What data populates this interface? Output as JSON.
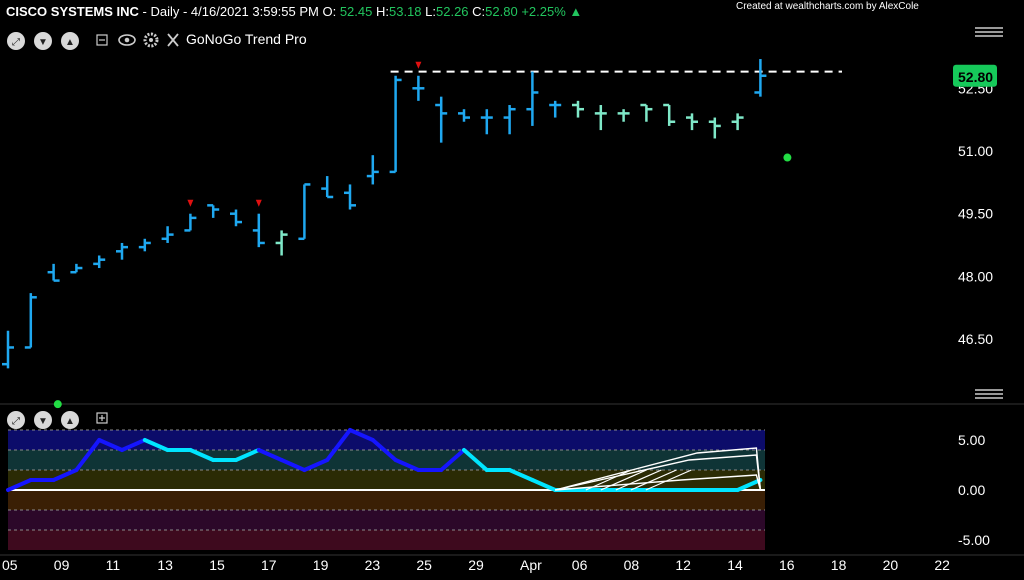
{
  "header": {
    "symbol": "CISCO SYSTEMS INC",
    "info": " - Daily - 4/16/2021 3:59:55 PM ",
    "o_label": "O: ",
    "o_value": "52.45",
    "h_label": " H:",
    "h_value": "53.18",
    "l_label": " L:",
    "l_value": "52.26",
    "c_label": " C:",
    "c_value": "52.80",
    "change": " +2.25%",
    "credit": "Created at wealthcharts.com by AlexCole",
    "indicator_name": "GoNoGo Trend Pro"
  },
  "colors": {
    "background": "#000000",
    "go_strong": "#1fa8f0",
    "go_weak": "#7fe8c8",
    "signal": "#e01010",
    "dot": "#22dd44",
    "osc_blue": "#1515ff",
    "osc_cyan": "#00e5ff",
    "price_badge": "#16c95a"
  },
  "chart_data": {
    "type": "ohlc",
    "price_axis": {
      "ticks": [
        46.5,
        48.0,
        49.5,
        51.0,
        52.5
      ],
      "tick_labels": [
        "46.50",
        "48.00",
        "49.50",
        "51.00",
        "52.50"
      ],
      "last_price_label": "52.80"
    },
    "x_tick_labels": [
      "05",
      "09",
      "11",
      "13",
      "15",
      "17",
      "19",
      "23",
      "25",
      "29",
      "Apr",
      "06",
      "08",
      "12",
      "14",
      "16",
      "18",
      "20",
      "22"
    ],
    "bars": [
      {
        "o": 45.9,
        "h": 46.7,
        "l": 45.8,
        "c": 46.3,
        "s": "strong"
      },
      {
        "o": 46.3,
        "h": 47.6,
        "l": 46.3,
        "c": 47.5,
        "s": "strong"
      },
      {
        "o": 48.1,
        "h": 48.3,
        "l": 47.9,
        "c": 47.9,
        "s": "strong"
      },
      {
        "o": 48.1,
        "h": 48.3,
        "l": 48.1,
        "c": 48.2,
        "s": "strong"
      },
      {
        "o": 48.3,
        "h": 48.5,
        "l": 48.2,
        "c": 48.4,
        "s": "strong"
      },
      {
        "o": 48.6,
        "h": 48.8,
        "l": 48.4,
        "c": 48.7,
        "s": "strong"
      },
      {
        "o": 48.7,
        "h": 48.9,
        "l": 48.6,
        "c": 48.8,
        "s": "strong"
      },
      {
        "o": 48.9,
        "h": 49.2,
        "l": 48.8,
        "c": 49.0,
        "s": "strong"
      },
      {
        "o": 49.1,
        "h": 49.5,
        "l": 49.1,
        "c": 49.4,
        "s": "strong"
      },
      {
        "o": 49.7,
        "h": 49.7,
        "l": 49.4,
        "c": 49.6,
        "s": "strong"
      },
      {
        "o": 49.5,
        "h": 49.6,
        "l": 49.2,
        "c": 49.3,
        "s": "strong"
      },
      {
        "o": 49.1,
        "h": 49.5,
        "l": 48.7,
        "c": 48.8,
        "s": "strong"
      },
      {
        "o": 48.8,
        "h": 49.1,
        "l": 48.5,
        "c": 49.0,
        "s": "weak"
      },
      {
        "o": 48.9,
        "h": 50.2,
        "l": 48.9,
        "c": 50.2,
        "s": "strong"
      },
      {
        "o": 50.1,
        "h": 50.4,
        "l": 49.9,
        "c": 49.9,
        "s": "strong"
      },
      {
        "o": 50.0,
        "h": 50.2,
        "l": 49.6,
        "c": 49.7,
        "s": "strong"
      },
      {
        "o": 50.4,
        "h": 50.9,
        "l": 50.2,
        "c": 50.5,
        "s": "strong"
      },
      {
        "o": 50.5,
        "h": 52.8,
        "l": 50.5,
        "c": 52.7,
        "s": "strong"
      },
      {
        "o": 52.5,
        "h": 52.8,
        "l": 52.2,
        "c": 52.5,
        "s": "strong"
      },
      {
        "o": 52.1,
        "h": 52.3,
        "l": 51.2,
        "c": 51.9,
        "s": "strong"
      },
      {
        "o": 51.9,
        "h": 52.0,
        "l": 51.7,
        "c": 51.8,
        "s": "strong"
      },
      {
        "o": 51.8,
        "h": 52.0,
        "l": 51.4,
        "c": 51.8,
        "s": "strong"
      },
      {
        "o": 51.8,
        "h": 52.1,
        "l": 51.4,
        "c": 52.0,
        "s": "strong"
      },
      {
        "o": 52.0,
        "h": 52.9,
        "l": 51.6,
        "c": 52.4,
        "s": "strong"
      },
      {
        "o": 52.1,
        "h": 52.2,
        "l": 51.8,
        "c": 52.1,
        "s": "strong"
      },
      {
        "o": 52.1,
        "h": 52.2,
        "l": 51.8,
        "c": 52.0,
        "s": "weak"
      },
      {
        "o": 51.9,
        "h": 52.1,
        "l": 51.5,
        "c": 51.9,
        "s": "weak"
      },
      {
        "o": 51.9,
        "h": 52.0,
        "l": 51.7,
        "c": 51.9,
        "s": "weak"
      },
      {
        "o": 52.1,
        "h": 52.1,
        "l": 51.7,
        "c": 52.0,
        "s": "weak"
      },
      {
        "o": 52.1,
        "h": 52.1,
        "l": 51.6,
        "c": 51.7,
        "s": "weak"
      },
      {
        "o": 51.8,
        "h": 51.9,
        "l": 51.5,
        "c": 51.7,
        "s": "weak"
      },
      {
        "o": 51.7,
        "h": 51.8,
        "l": 51.3,
        "c": 51.6,
        "s": "weak"
      },
      {
        "o": 51.7,
        "h": 51.9,
        "l": 51.5,
        "c": 51.8,
        "s": "weak"
      },
      {
        "o": 52.4,
        "h": 53.2,
        "l": 52.3,
        "c": 52.8,
        "s": "strong"
      }
    ],
    "resistance_level": 52.9,
    "signal_markers": [
      8,
      11,
      18
    ],
    "dot_markers": [
      {
        "bar": 1,
        "price": 45.9
      },
      {
        "bar": 33,
        "price": 51.8
      }
    ],
    "oscillator": {
      "ticks": [
        5,
        0,
        -5
      ],
      "tick_labels": [
        "5.00",
        "0.00",
        "-5.00"
      ],
      "values": [
        0,
        1,
        1,
        2,
        5,
        4,
        5,
        4,
        4,
        3,
        3,
        4,
        3,
        2,
        3,
        6,
        5,
        3,
        2,
        2,
        4,
        2,
        2,
        1,
        0,
        0,
        0,
        0,
        0,
        0,
        0,
        0,
        0,
        1
      ],
      "colors": [
        "b",
        "b",
        "b",
        "b",
        "b",
        "b",
        "c",
        "c",
        "c",
        "c",
        "c",
        "b",
        "b",
        "b",
        "b",
        "b",
        "b",
        "b",
        "b",
        "b",
        "c",
        "c",
        "c",
        "c",
        "c",
        "c",
        "c",
        "c",
        "c",
        "c",
        "c",
        "c",
        "c",
        "c"
      ]
    }
  }
}
